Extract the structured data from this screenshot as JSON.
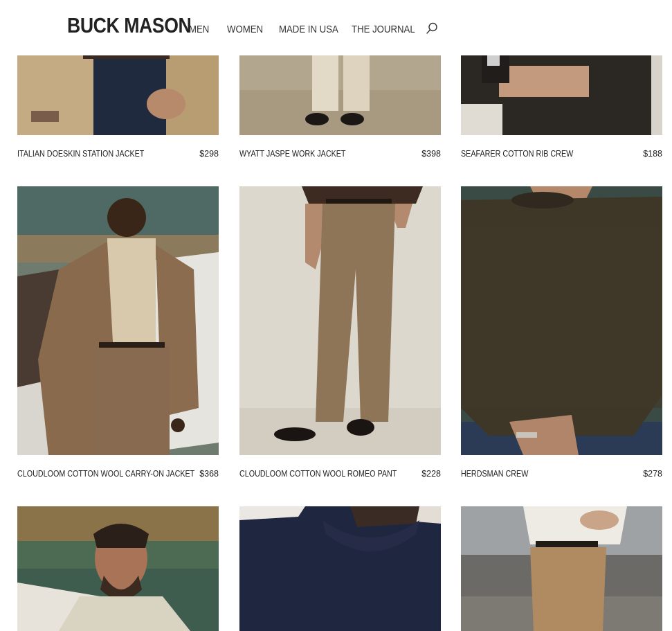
{
  "brand": {
    "logo_text": "BUCK MASON"
  },
  "nav": {
    "items": [
      {
        "label": "MEN"
      },
      {
        "label": "WOMEN"
      },
      {
        "label": "MADE IN USA"
      },
      {
        "label": "THE JOURNAL"
      }
    ],
    "search_icon": "search-icon"
  },
  "products": [
    {
      "name": "ITALIAN DOESKIN STATION JACKET",
      "price": "$298"
    },
    {
      "name": "WYATT JASPE WORK JACKET",
      "price": "$398"
    },
    {
      "name": "SEAFARER COTTON RIB CREW",
      "price": "$188"
    },
    {
      "name": "CLOUDLOOM COTTON WOOL CARRY-ON JACKET",
      "price": "$368"
    },
    {
      "name": "CLOUDLOOM COTTON WOOL ROMEO PANT",
      "price": "$228"
    },
    {
      "name": "HERDSMAN CREW",
      "price": "$278"
    },
    {
      "name": "",
      "price": ""
    },
    {
      "name": "",
      "price": ""
    },
    {
      "name": "",
      "price": ""
    }
  ]
}
